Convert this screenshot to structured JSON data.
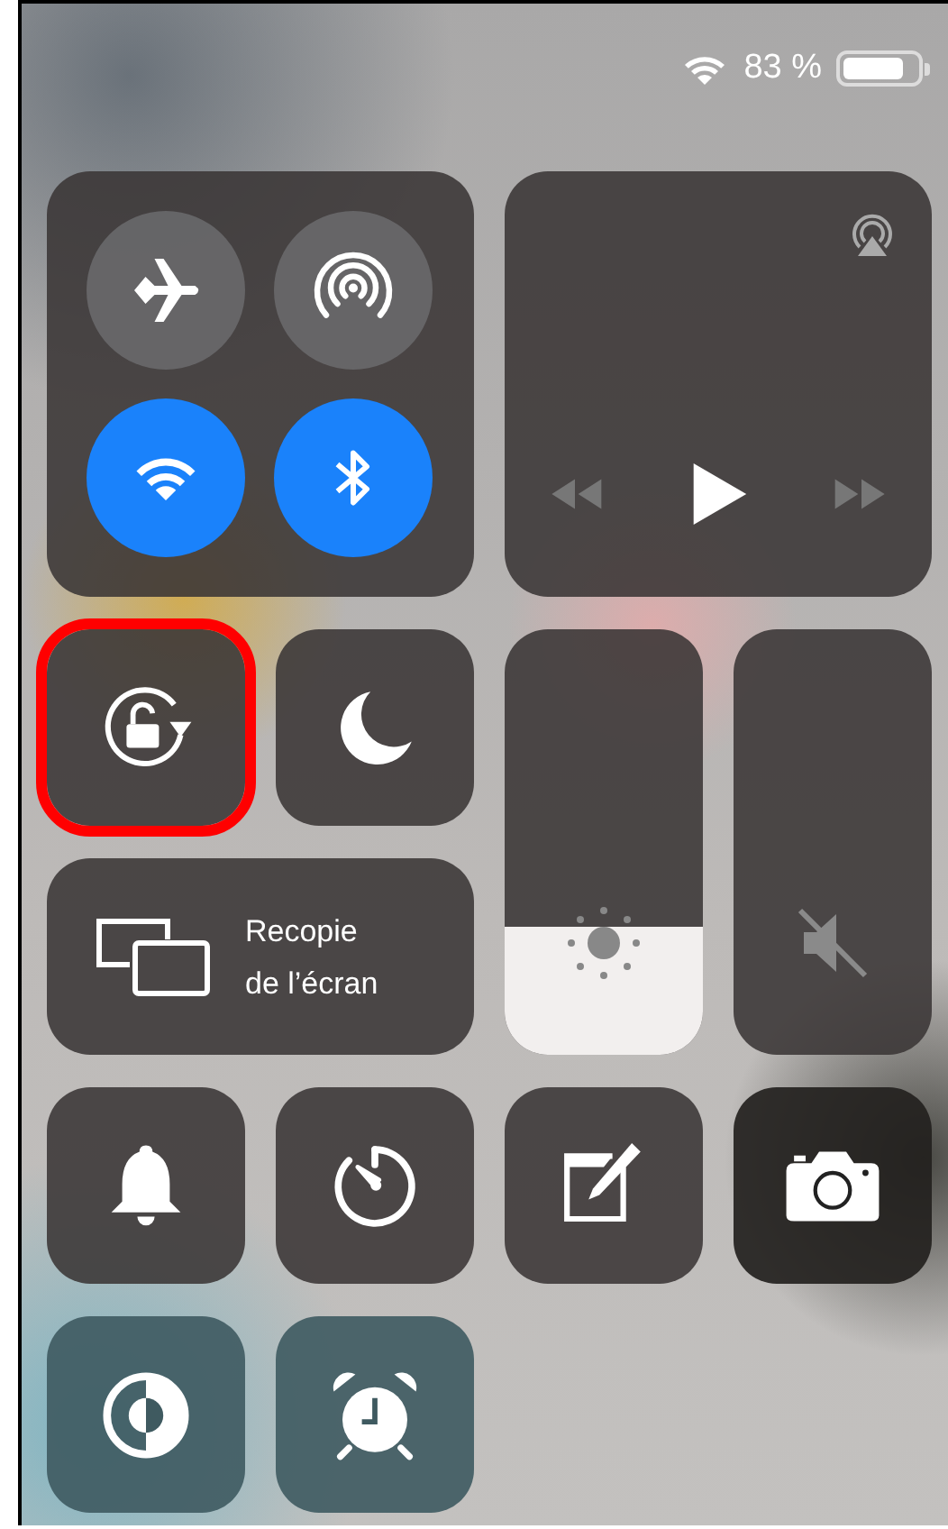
{
  "status_bar": {
    "wifi": true,
    "battery_text": "83 %"
  },
  "connectivity": [
    {
      "kind": "airplane",
      "on": false
    },
    {
      "kind": "cellular",
      "on": false
    },
    {
      "kind": "wifi",
      "on": true
    },
    {
      "kind": "bluetooth",
      "on": true
    }
  ],
  "media": {
    "playing": false
  },
  "toggles": [
    {
      "kind": "rotation-lock",
      "on": false,
      "highlighted": true
    },
    {
      "kind": "do-not-disturb",
      "on": false,
      "highlighted": false
    }
  ],
  "screen_mirroring": {
    "label": "Recopie de l’écran"
  },
  "brightness": {
    "level": 0.3
  },
  "volume": {
    "muted": true
  },
  "shortcuts": [
    {
      "kind": "bell"
    },
    {
      "kind": "timer"
    },
    {
      "kind": "notes"
    },
    {
      "kind": "camera"
    },
    {
      "kind": "contrast"
    },
    {
      "kind": "alarm"
    }
  ]
}
